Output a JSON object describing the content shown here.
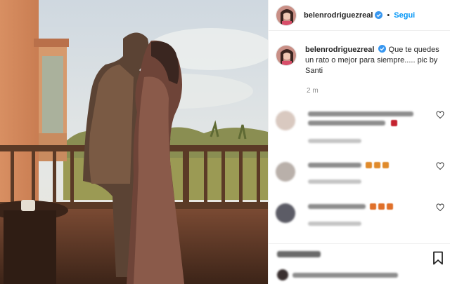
{
  "post": {
    "username": "belenrodriguezreal",
    "verified": true,
    "follow_label": "Segui",
    "separator": "•",
    "caption": "Que te quedes un rato o mejor para siempre..... pic by Santi",
    "time_ago": "2 m"
  },
  "icons": {
    "verified": "verified-badge-icon",
    "like": "heart-icon",
    "save": "bookmark-icon"
  },
  "colors": {
    "link": "#0095f6",
    "verified": "#3897f0",
    "text": "#262626",
    "muted": "#8e8e8e"
  }
}
